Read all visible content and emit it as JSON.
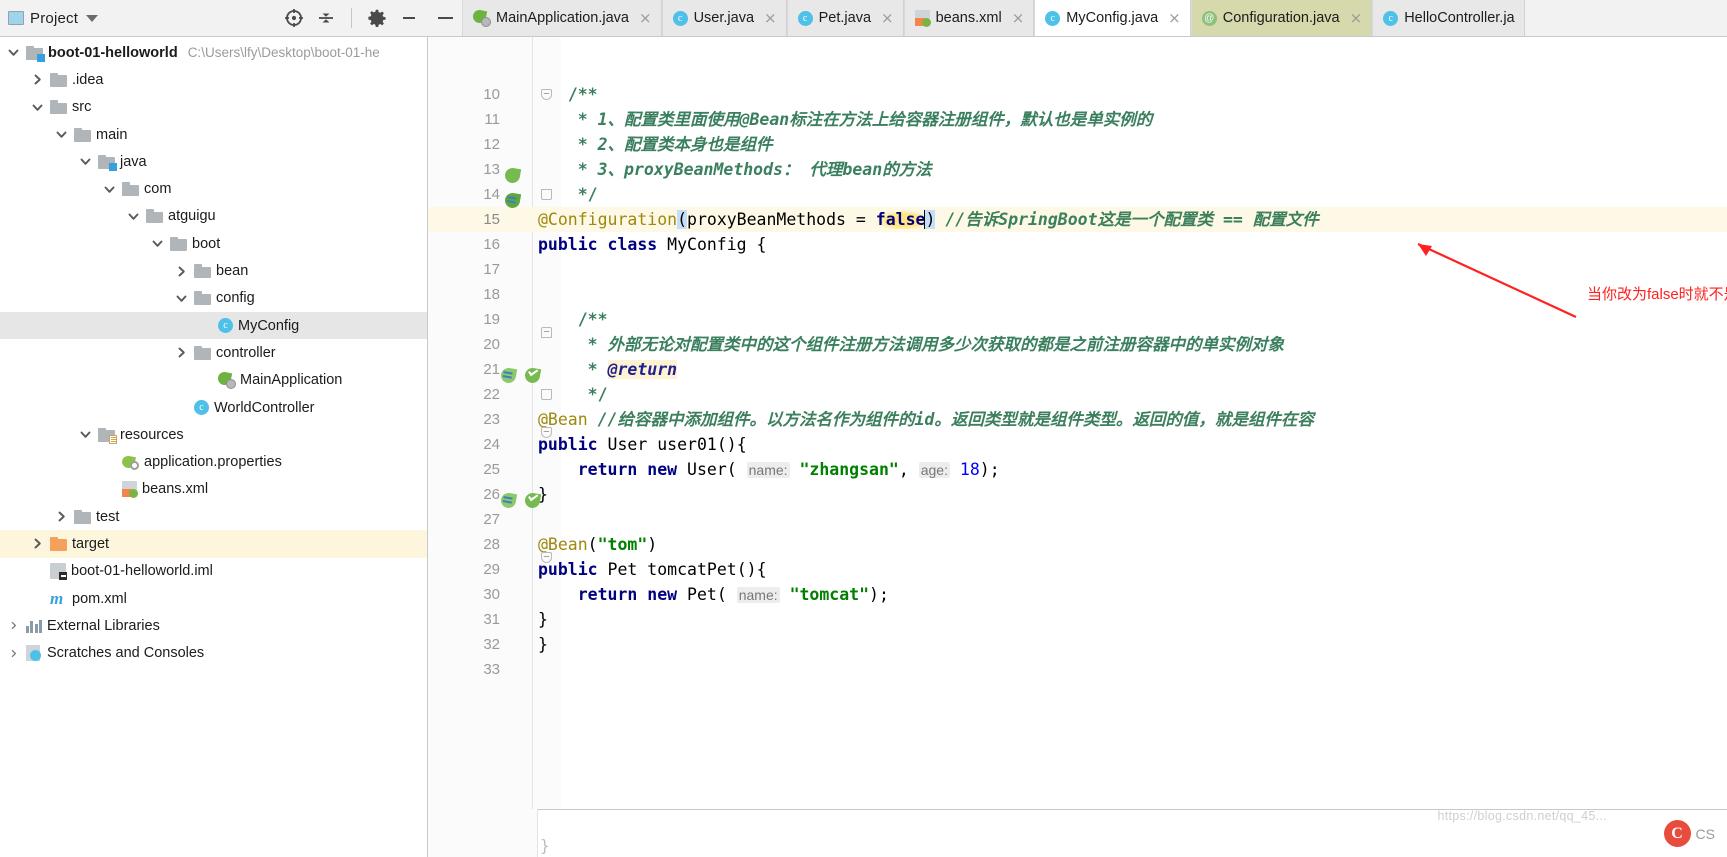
{
  "project_panel": {
    "title": "Project",
    "icons": {
      "project": "project-window-icon",
      "dropdown": "chevron-down-icon",
      "locate": "locate-target-icon",
      "collapse": "collapse-all-icon",
      "settings": "gear-icon",
      "hide": "hide-panel-icon"
    }
  },
  "tree": [
    {
      "label": "boot-01-helloworld",
      "path": "C:\\Users\\lfy\\Desktop\\boot-01-he",
      "icon": "folder-module-icon",
      "indent": 0,
      "arrow": "down",
      "bold": true,
      "state": "none"
    },
    {
      "label": ".idea",
      "icon": "folder-icon",
      "indent": 1,
      "arrow": "right",
      "state": "none"
    },
    {
      "label": "src",
      "icon": "folder-icon",
      "indent": 1,
      "arrow": "down",
      "state": "none"
    },
    {
      "label": "main",
      "icon": "folder-icon",
      "indent": 2,
      "arrow": "down",
      "state": "none"
    },
    {
      "label": "java",
      "icon": "folder-source-icon",
      "indent": 3,
      "arrow": "down",
      "state": "none"
    },
    {
      "label": "com",
      "icon": "folder-icon",
      "indent": 4,
      "arrow": "down",
      "state": "none"
    },
    {
      "label": "atguigu",
      "icon": "folder-icon",
      "indent": 5,
      "arrow": "down",
      "state": "none"
    },
    {
      "label": "boot",
      "icon": "folder-icon",
      "indent": 6,
      "arrow": "down",
      "state": "none"
    },
    {
      "label": "bean",
      "icon": "folder-icon",
      "indent": 7,
      "arrow": "right",
      "state": "none"
    },
    {
      "label": "config",
      "icon": "folder-icon",
      "indent": 7,
      "arrow": "down",
      "state": "none"
    },
    {
      "label": "MyConfig",
      "icon": "class-icon",
      "indent": 8,
      "arrow": "none",
      "state": "selected-gray"
    },
    {
      "label": "controller",
      "icon": "folder-icon",
      "indent": 7,
      "arrow": "right",
      "state": "none"
    },
    {
      "label": "MainApplication",
      "icon": "spring-run-icon",
      "indent": 8,
      "arrow": "none",
      "state": "none"
    },
    {
      "label": "WorldController",
      "icon": "class-icon",
      "indent": 7,
      "arrow": "none",
      "state": "none"
    },
    {
      "label": "resources",
      "icon": "folder-resources-icon",
      "indent": 3,
      "arrow": "down",
      "state": "none"
    },
    {
      "label": "application.properties",
      "icon": "spring-properties-icon",
      "indent": 4,
      "arrow": "none",
      "state": "none"
    },
    {
      "label": "beans.xml",
      "icon": "spring-xml-icon",
      "indent": 4,
      "arrow": "none",
      "state": "none"
    },
    {
      "label": "test",
      "icon": "folder-icon",
      "indent": 2,
      "arrow": "right",
      "state": "none"
    },
    {
      "label": "target",
      "icon": "folder-orange-icon",
      "indent": 1,
      "arrow": "right",
      "state": "selected-yellow"
    },
    {
      "label": "boot-01-helloworld.iml",
      "icon": "iml-icon",
      "indent": 1,
      "arrow": "none",
      "state": "none"
    },
    {
      "label": "pom.xml",
      "icon": "maven-icon",
      "indent": 1,
      "arrow": "none",
      "state": "none"
    },
    {
      "label": "External Libraries",
      "icon": "external-libraries-icon",
      "indent": 0,
      "arrow": "right-thin",
      "state": "none"
    },
    {
      "label": "Scratches and Consoles",
      "icon": "scratches-icon",
      "indent": 0,
      "arrow": "right-thin",
      "state": "none"
    }
  ],
  "tabs": [
    {
      "label": "MainApplication.java",
      "icon": "spring-run-icon",
      "state": "inactive",
      "close": "×"
    },
    {
      "label": "User.java",
      "icon": "class-icon",
      "state": "inactive",
      "close": "×"
    },
    {
      "label": "Pet.java",
      "icon": "class-icon",
      "state": "inactive",
      "close": "×"
    },
    {
      "label": "beans.xml",
      "icon": "spring-xml-icon",
      "state": "inactive",
      "close": "×"
    },
    {
      "label": "MyConfig.java",
      "icon": "class-icon",
      "state": "active",
      "close": "×"
    },
    {
      "label": "Configuration.java",
      "icon": "annotation-icon",
      "state": "olive",
      "close": "×"
    },
    {
      "label": "HelloController.ja",
      "icon": "class-icon",
      "state": "inactive",
      "close": ""
    }
  ],
  "editor": {
    "first_line_number": 10,
    "last_line_number": 33,
    "cursor_line": 15,
    "lines": [
      {
        "n": 10,
        "segments": [
          {
            "t": "   ",
            "c": "plain"
          },
          {
            "t": "/**",
            "c": "jdoc-plain"
          }
        ]
      },
      {
        "n": 11,
        "segments": [
          {
            "t": "    * ",
            "c": "jdoc-plain"
          },
          {
            "t": "1、配置类里面使用@Bean标注在方法上给容器注册组件，默认也是单实例的",
            "c": "jdoc"
          }
        ]
      },
      {
        "n": 12,
        "segments": [
          {
            "t": "    * ",
            "c": "jdoc-plain"
          },
          {
            "t": "2、配置类本身也是组件",
            "c": "jdoc"
          }
        ]
      },
      {
        "n": 13,
        "segments": [
          {
            "t": "    * ",
            "c": "jdoc-plain"
          },
          {
            "t": "3、proxyBeanMethods： 代理bean的方法",
            "c": "jdoc"
          }
        ]
      },
      {
        "n": 14,
        "segments": [
          {
            "t": "    */",
            "c": "jdoc-plain"
          }
        ]
      },
      {
        "n": 15,
        "segments": [
          {
            "t": "@Configuration",
            "c": "anno"
          },
          {
            "t": "(",
            "c": "paren"
          },
          {
            "t": "proxyBeanMethods",
            "c": "plain"
          },
          {
            "t": " = ",
            "c": "plain"
          },
          {
            "t": "false",
            "c": "kw-false"
          },
          {
            "t": ")",
            "c": "paren"
          },
          {
            "t": " ",
            "c": "plain"
          },
          {
            "t": "//告诉SpringBoot这是一个配置类 == 配置文件",
            "c": "cmt"
          }
        ]
      },
      {
        "n": 16,
        "segments": [
          {
            "t": "public class ",
            "c": "kw"
          },
          {
            "t": "MyConfig {",
            "c": "plain"
          }
        ]
      },
      {
        "n": 17,
        "segments": []
      },
      {
        "n": 18,
        "segments": []
      },
      {
        "n": 19,
        "segments": [
          {
            "t": "    /**",
            "c": "jdoc-plain"
          }
        ]
      },
      {
        "n": 20,
        "segments": [
          {
            "t": "     * ",
            "c": "jdoc-plain"
          },
          {
            "t": "外部无论对配置类中的这个组件注册方法调用多少次获取的都是之前注册容器中的单实例对象",
            "c": "jdoc"
          }
        ]
      },
      {
        "n": 21,
        "segments": [
          {
            "t": "     * ",
            "c": "jdoc-plain"
          },
          {
            "t": "@return",
            "c": "jtag"
          }
        ]
      },
      {
        "n": 22,
        "segments": [
          {
            "t": "     */",
            "c": "jdoc-plain"
          }
        ]
      },
      {
        "n": 23,
        "segments": [
          {
            "t": "@Bean",
            "c": "anno"
          },
          {
            "t": " ",
            "c": "plain"
          },
          {
            "t": "//给容器中添加组件。以方法名作为组件的id。返回类型就是组件类型。返回的值，就是组件在容",
            "c": "cmt"
          }
        ]
      },
      {
        "n": 24,
        "segments": [
          {
            "t": "public ",
            "c": "kw"
          },
          {
            "t": "User ",
            "c": "plain"
          },
          {
            "t": "user01(){",
            "c": "plain"
          }
        ]
      },
      {
        "n": 25,
        "segments": [
          {
            "t": "    ",
            "c": "plain"
          },
          {
            "t": "return new ",
            "c": "kw"
          },
          {
            "t": "User( ",
            "c": "plain"
          },
          {
            "t": "name:",
            "c": "hint"
          },
          {
            "t": " ",
            "c": "plain"
          },
          {
            "t": "\"zhangsan\"",
            "c": "str"
          },
          {
            "t": ", ",
            "c": "plain"
          },
          {
            "t": "age:",
            "c": "hint"
          },
          {
            "t": " ",
            "c": "plain"
          },
          {
            "t": "18",
            "c": "num2"
          },
          {
            "t": ");",
            "c": "plain"
          }
        ]
      },
      {
        "n": 26,
        "segments": [
          {
            "t": "}",
            "c": "plain"
          }
        ]
      },
      {
        "n": 27,
        "segments": []
      },
      {
        "n": 28,
        "segments": [
          {
            "t": "@Bean",
            "c": "anno"
          },
          {
            "t": "(",
            "c": "plain"
          },
          {
            "t": "\"tom\"",
            "c": "str"
          },
          {
            "t": ")",
            "c": "plain"
          }
        ]
      },
      {
        "n": 29,
        "segments": [
          {
            "t": "public ",
            "c": "kw"
          },
          {
            "t": "Pet ",
            "c": "plain"
          },
          {
            "t": "tomcatPet(){",
            "c": "plain"
          }
        ]
      },
      {
        "n": 30,
        "segments": [
          {
            "t": "    ",
            "c": "plain"
          },
          {
            "t": "return new ",
            "c": "kw"
          },
          {
            "t": "Pet( ",
            "c": "plain"
          },
          {
            "t": "name:",
            "c": "hint"
          },
          {
            "t": " ",
            "c": "plain"
          },
          {
            "t": "\"tomcat\"",
            "c": "str"
          },
          {
            "t": ");",
            "c": "plain"
          }
        ]
      },
      {
        "n": 31,
        "segments": [
          {
            "t": "}",
            "c": "plain"
          }
        ]
      },
      {
        "n": 32,
        "segments": [
          {
            "t": "}",
            "c": "plain"
          }
        ]
      },
      {
        "n": 33,
        "segments": []
      }
    ],
    "gutter_marks": [
      {
        "line": 15,
        "icon": "spring-bean-leaf-icon"
      },
      {
        "line": 16,
        "icon": "spring-bean-navigate-icon"
      },
      {
        "line": 23,
        "icon": "spring-bean-arrows-icon"
      },
      {
        "line": 23,
        "icon": "spring-bean-check-icon"
      },
      {
        "line": 28,
        "icon": "spring-bean-arrows-icon"
      },
      {
        "line": 28,
        "icon": "spring-bean-check-icon"
      }
    ]
  },
  "annotation": {
    "text": "当你改为false时就不是代理对象了",
    "color": "#ff2020",
    "arrow": "red-arrow-pointing-up-left"
  },
  "footer": {
    "watermark": "https://blog.csdn.net/qq_45...",
    "badge_letter": "C",
    "badge_text": "CS"
  },
  "colors": {
    "accent": "#4fc0e8",
    "spring_green": "#6db33f",
    "annotation_red": "#ff2020",
    "selection_blue": "#c5dffb",
    "current_line": "#fdf9e6"
  }
}
